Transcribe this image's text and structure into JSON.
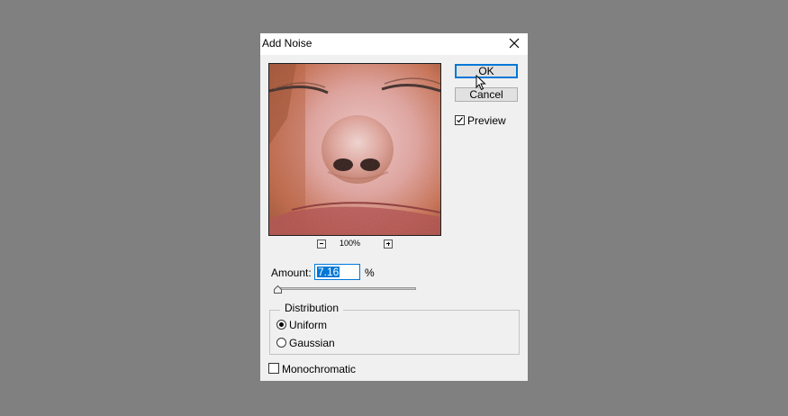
{
  "dialog": {
    "title": "Add Noise"
  },
  "preview": {
    "zoom_label": "100%"
  },
  "buttons": {
    "ok_label": "OK",
    "cancel_label": "Cancel"
  },
  "options": {
    "preview_label": "Preview",
    "preview_checked": true,
    "amount_label": "Amount:",
    "amount_value": "7.16",
    "amount_unit": "%",
    "amount_slider_fraction": 0.0179
  },
  "distribution": {
    "legend": "Distribution",
    "uniform_label": "Uniform",
    "gaussian_label": "Gaussian",
    "selected": "Uniform"
  },
  "monochromatic": {
    "label": "Monochromatic",
    "checked": false
  },
  "colors": {
    "background": "#808080",
    "dialog": "#f0f0f0",
    "accent": "#0078d7"
  },
  "icons": {
    "close": "close-icon",
    "cursor": "mouse-pointer-icon",
    "zoom_out": "zoom-out-icon",
    "zoom_in": "zoom-in-icon",
    "preview_check": "checkmark-icon"
  }
}
